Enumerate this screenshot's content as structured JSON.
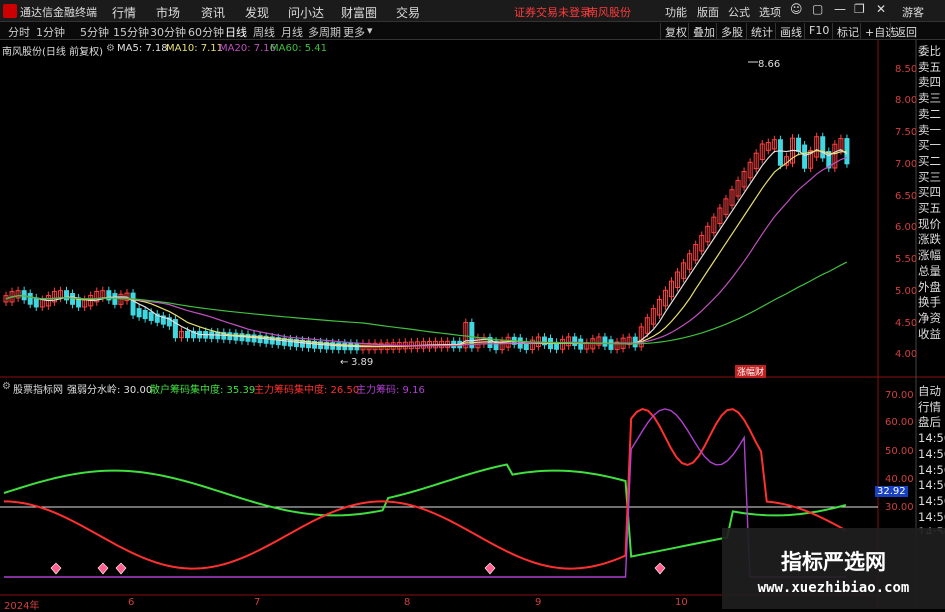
{
  "titlebar": {
    "app_name": "通达信金融终端",
    "menus": [
      "行情",
      "市场",
      "资讯",
      "发现",
      "问小达",
      "财富圈",
      "交易"
    ],
    "warning": "证券交易未登录",
    "stock_name": "南风股份",
    "right_menus": [
      "功能",
      "版面",
      "公式",
      "选项"
    ],
    "guest": "游客",
    "colors": {
      "warning": "#ff3b3b",
      "logo": "#cc0000"
    }
  },
  "toolbar": {
    "periods": [
      "分时",
      "1分钟",
      "5分钟",
      "15分钟",
      "30分钟",
      "60分钟",
      "日线",
      "周线",
      "月线",
      "多周期",
      "更多"
    ],
    "active": "日线",
    "right_buttons": [
      "复权",
      "叠加",
      "多股",
      "统计",
      "画线",
      "F10",
      "标记",
      "+自选",
      "返回"
    ]
  },
  "price_panel": {
    "title": "南风股份(日线 前复权)",
    "ma": [
      {
        "label": "MA5: 7.18",
        "color": "#e0e0e0"
      },
      {
        "label": "MA10: 7.11",
        "color": "#e8e070"
      },
      {
        "label": "MA20: 7.16",
        "color": "#c050c0"
      },
      {
        "label": "MA60: 5.41",
        "color": "#40c040"
      }
    ],
    "y_ticks": [
      "8.50",
      "8.00",
      "7.50",
      "7.00",
      "6.50",
      "6.00",
      "5.50",
      "5.00",
      "4.50",
      "4.00"
    ],
    "high_label": "8.66",
    "low_label": "3.89",
    "badge": "涨幅财"
  },
  "right_panel": {
    "items": [
      "委比",
      "卖五",
      "卖四",
      "卖三",
      "卖二",
      "卖一",
      "买一",
      "买二",
      "买三",
      "买四",
      "买五",
      "现价",
      "涨跌",
      "涨幅",
      "总量",
      "外盘",
      "换手",
      "净资",
      "收益",
      "自动",
      "行情",
      "盘后",
      "14:50",
      "14:50",
      "14:50",
      "14:50",
      "14:50",
      "14:50",
      "14:50"
    ]
  },
  "indicator_panel": {
    "name": "股票指标网",
    "line0": "强弱分水岭: 30.00",
    "line1": "散户筹码集中度: 35.39",
    "line2": "主力筹码集中度: 26.50",
    "line3": "主力筹码: 9.16",
    "y_ticks": [
      "70.00",
      "60.00",
      "50.00",
      "40.00",
      "30.00"
    ],
    "cursor_value": "32.92",
    "colors": {
      "retail": "#40e040",
      "main": "#ff3030",
      "chip": "#b040d0",
      "line0": "#e0e0e0"
    }
  },
  "dates": [
    "2024年",
    "6",
    "7",
    "8",
    "9",
    "10"
  ],
  "watermark": {
    "line1": "指标严选网",
    "line2": "www.xuezhibiao.com"
  }
}
